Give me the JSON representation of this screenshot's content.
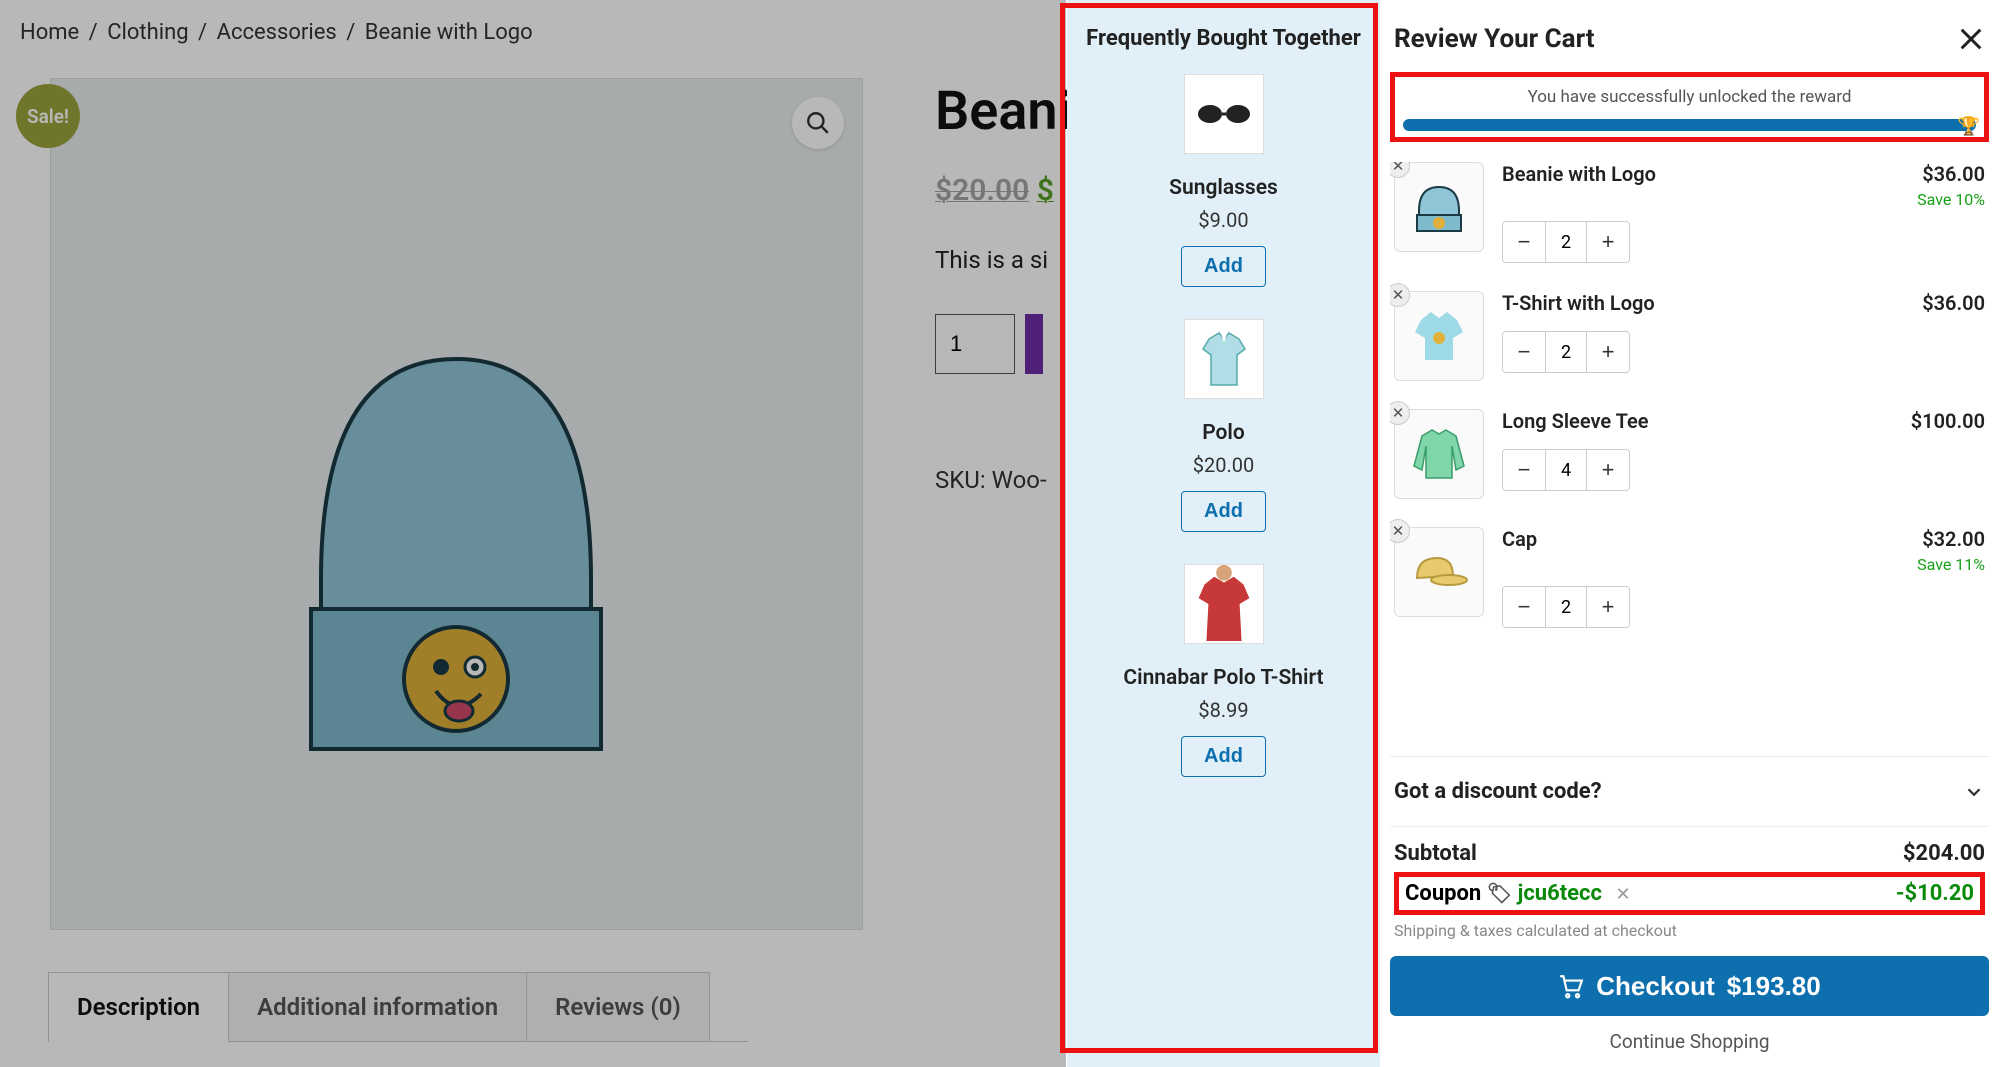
{
  "breadcrumbs": {
    "home": "Home",
    "clothing": "Clothing",
    "accessories": "Accessories",
    "current": "Beanie with Logo"
  },
  "sale_badge": "Sale!",
  "product": {
    "title": "Beanie with Logo",
    "price_old": "$20.00",
    "price_new": "$",
    "desc": "This is a si",
    "qty": "1",
    "sku": "SKU: Woo-"
  },
  "tabs": {
    "desc": "Description",
    "info": "Additional information",
    "reviews": "Reviews (0)"
  },
  "fbt": {
    "title": "Frequently Bought Together",
    "add_label": "Add",
    "items": [
      {
        "name": "Sunglasses",
        "price": "$9.00"
      },
      {
        "name": "Polo",
        "price": "$20.00"
      },
      {
        "name": "Cinnabar Polo T-Shirt",
        "price": "$8.99"
      }
    ]
  },
  "cart": {
    "title": "Review Your Cart",
    "reward_text": "You have successfully unlocked the reward",
    "items": [
      {
        "name": "Beanie with Logo",
        "price": "$36.00",
        "save": "Save 10%",
        "qty": "2"
      },
      {
        "name": "T-Shirt with Logo",
        "price": "$36.00",
        "save": "",
        "qty": "2"
      },
      {
        "name": "Long Sleeve Tee",
        "price": "$100.00",
        "save": "",
        "qty": "4"
      },
      {
        "name": "Cap",
        "price": "$32.00",
        "save": "Save 11%",
        "qty": "2"
      }
    ],
    "discount_label": "Got a discount code?",
    "subtotal_label": "Subtotal",
    "subtotal_value": "$204.00",
    "coupon_label": "Coupon",
    "coupon_code": "jcu6tecc",
    "coupon_amount": "-$10.20",
    "shipping_note": "Shipping & taxes calculated at checkout",
    "checkout_label": "Checkout",
    "checkout_total": "$193.80",
    "continue_label": "Continue Shopping"
  }
}
